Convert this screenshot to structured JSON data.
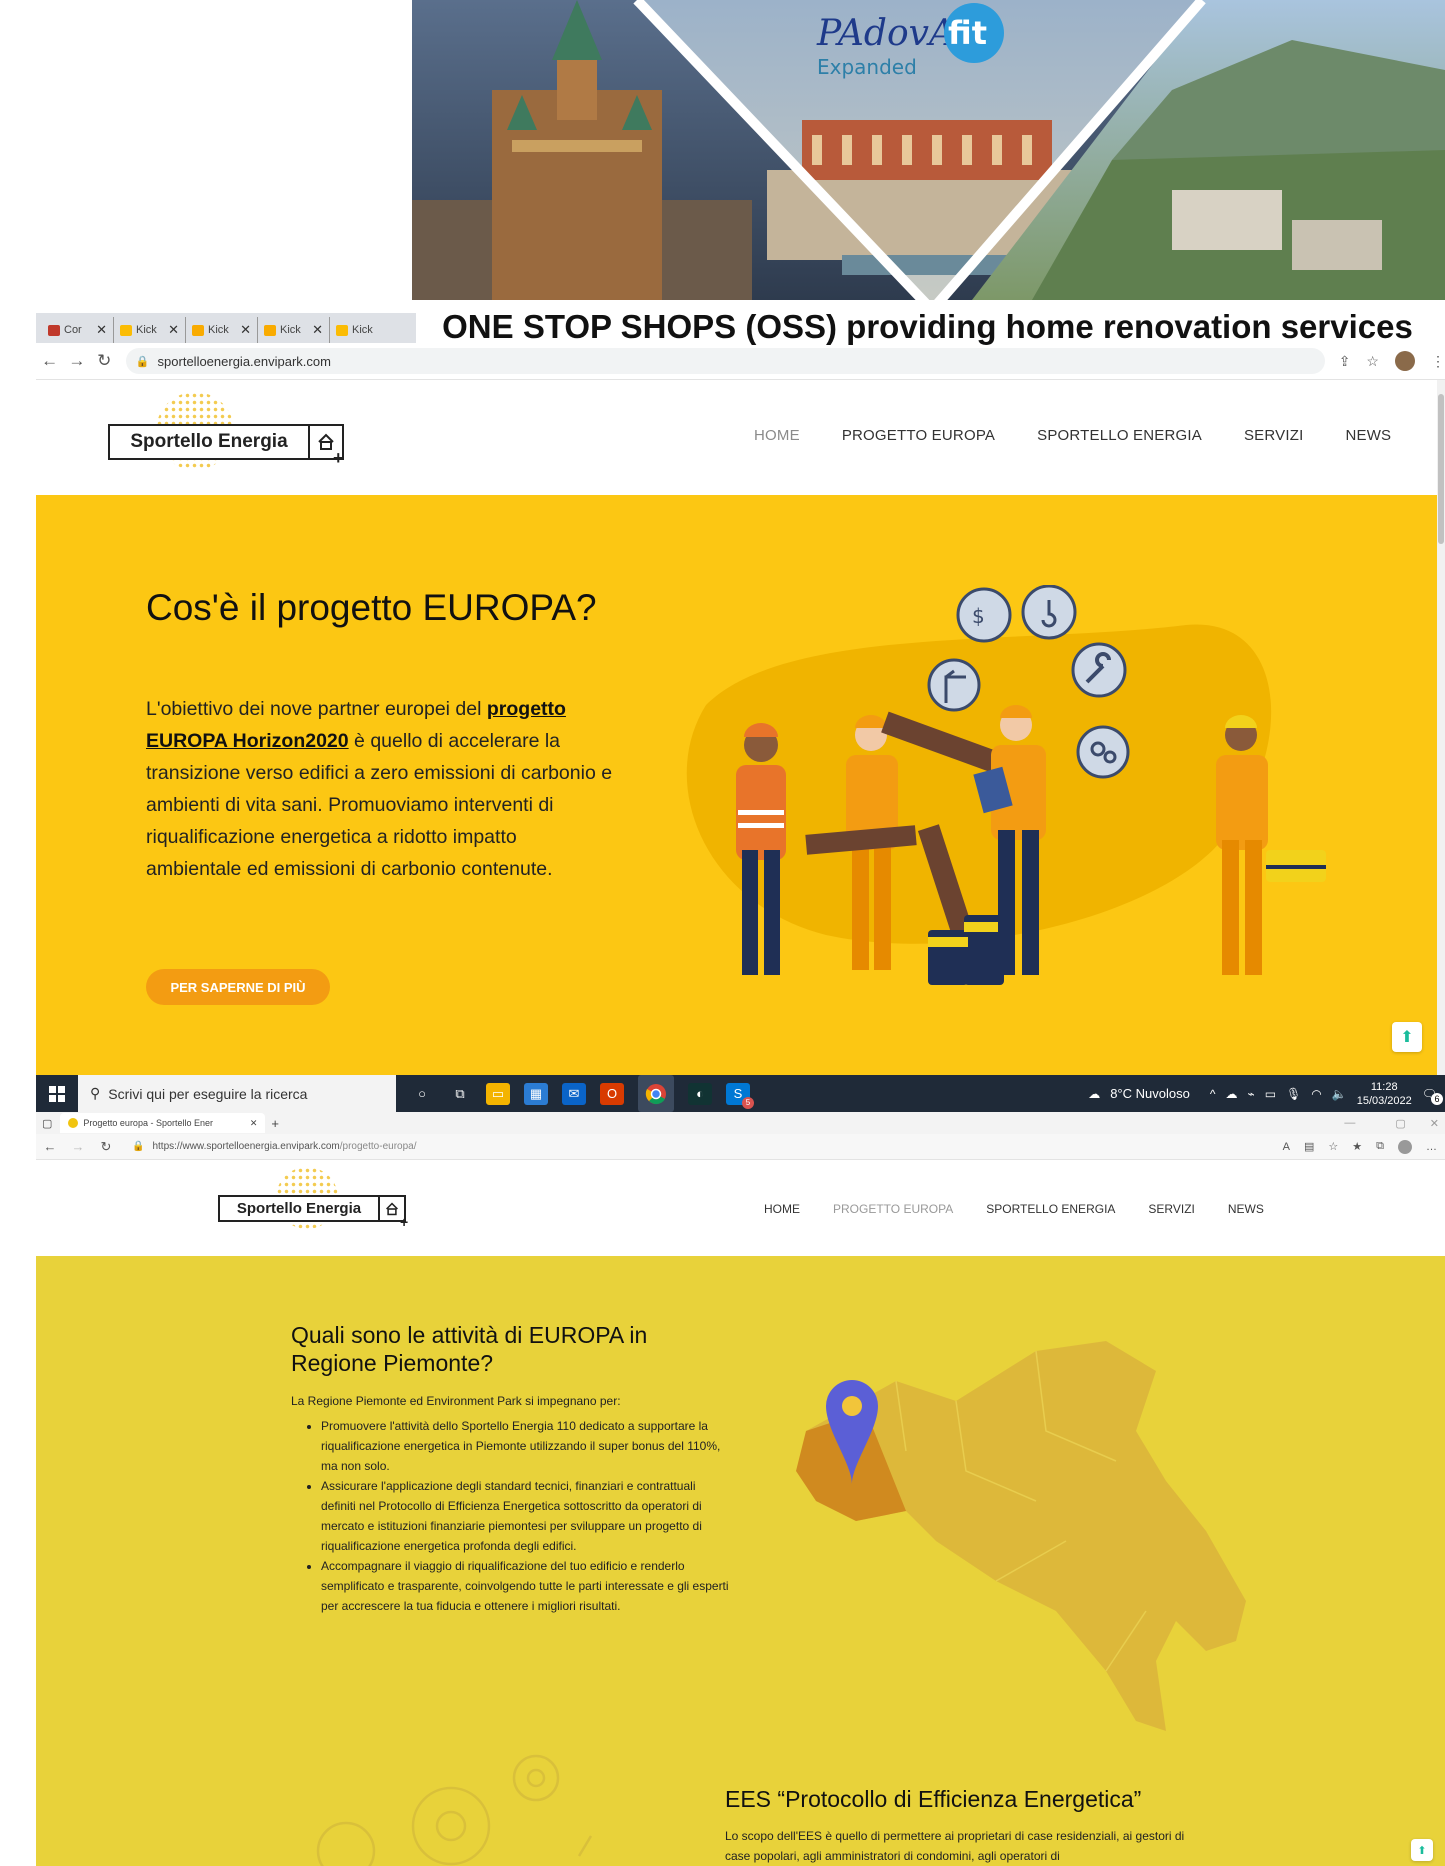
{
  "banner": {
    "brand_main": "PAdovA",
    "brand_fit": "fit",
    "brand_sub": "Expanded",
    "title": "ONE STOP SHOPS (OSS) providing home renovation services"
  },
  "browser1": {
    "tabs": [
      {
        "label": "Cor",
        "favicon_color": "#c0392b"
      },
      {
        "label": "Kick",
        "favicon_color": "#fbbc04"
      },
      {
        "label": "Kick",
        "favicon_color": "#f9ab00"
      },
      {
        "label": "Kick",
        "favicon_color": "#f9ab00"
      },
      {
        "label": "Kick",
        "favicon_color": "#fbbc04"
      }
    ],
    "url": "sportelloenergia.envipark.com"
  },
  "site": {
    "logo_text": "Sportello Energia",
    "nav": [
      "HOME",
      "PROGETTO EUROPA",
      "SPORTELLO ENERGIA",
      "SERVIZI",
      "NEWS"
    ],
    "accent_yellow": "#fcc713",
    "accent_orange": "#f39c12"
  },
  "hero1": {
    "title": "Cos'è il progetto EUROPA?",
    "text_before": "L'obiettivo dei nove partner europei del ",
    "link_text": "progetto EUROPA Horizon2020",
    "text_after": " è quello di accelerare la transizione verso edifici a zero emissioni di carbonio e ambienti di vita sani. Promuoviamo interventi di riqualificazione energetica a ridotto impatto ambientale ed emissioni di carbonio contenute.",
    "cta": "PER SAPERNE DI PIÙ"
  },
  "taskbar": {
    "search_placeholder": "Scrivi qui per eseguire la ricerca",
    "weather": "8°C  Nuvoloso",
    "time": "11:28",
    "date": "15/03/2022",
    "notifications": "6",
    "mail_badge": "5"
  },
  "browser2": {
    "tab_title": "Progetto europa - Sportello Ener",
    "url_prefix": "https://www.sportelloenergia.envipark.com",
    "url_path": "/progetto-europa/"
  },
  "hero2": {
    "title": "Quali sono le attività di EUROPA in Regione Piemonte?",
    "intro": "La Regione Piemonte ed Environment Park si impegnano per:",
    "bullets": [
      "Promuovere l'attività dello Sportello Energia 110 dedicato a supportare la riqualificazione energetica in Piemonte utilizzando il super bonus del 110%, ma non solo.",
      "Assicurare l'applicazione degli standard tecnici, finanziari e contrattuali definiti nel Protocollo di Efficienza Energetica sottoscritto da operatori di mercato e istituzioni finanziarie piemontesi per sviluppare un progetto di riqualificazione energetica profonda degli edifici.",
      "Accompagnare il viaggio di riqualificazione del tuo edificio e renderlo semplificato e trasparente, coinvolgendo tutte le parti interessate e gli esperti per accrescere la tua fiducia e ottenere i migliori risultati."
    ],
    "section2_title": "EES “Protocollo di Efficienza Energetica”",
    "section2_text": "Lo scopo dell'EES è quello di permettere ai proprietari di case residenziali, ai gestori di case popolari, agli amministratori di condomini, agli operatori di"
  }
}
